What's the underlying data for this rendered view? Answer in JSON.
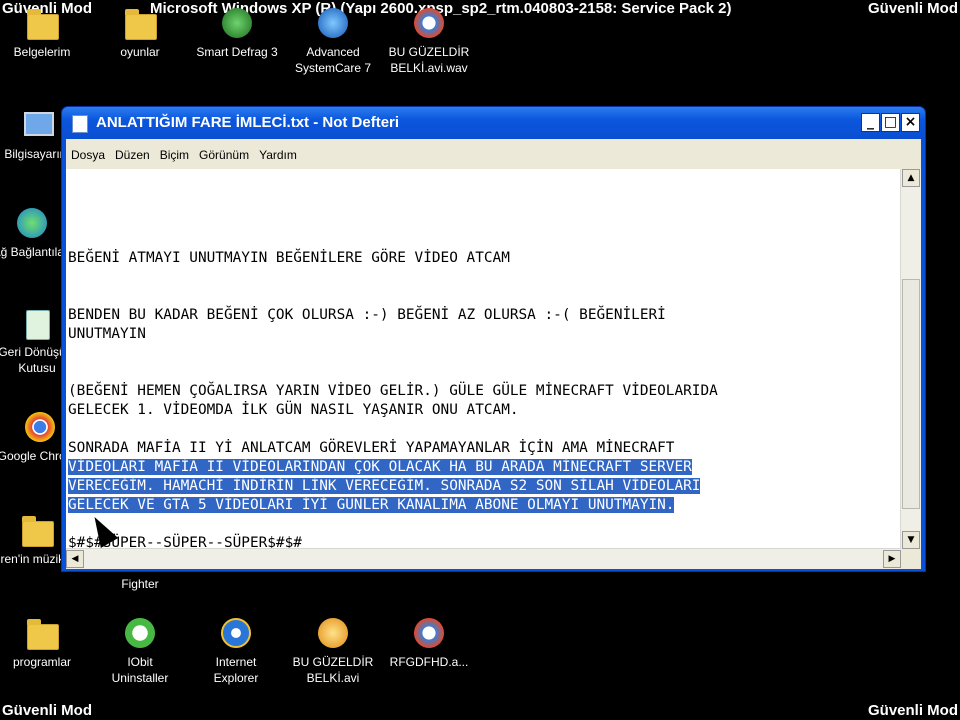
{
  "top_info": "Microsoft Windows XP (R) (Yapı 2600.xpsp_sp2_rtm.040803-2158: Service Pack 2)",
  "mode_labels": {
    "top_left": "Güvenli Mod",
    "top_right": "Güvenli Mod",
    "bottom_left": "Güvenli Mod",
    "bottom_right": "Güvenli Mod"
  },
  "desktop_icons": {
    "belgelerim": "Belgelerim",
    "oyunlar": "oyunlar",
    "smart_defrag": "Smart Defrag 3",
    "advanced_systemcare_1": "Advanced",
    "advanced_systemcare_2": "SystemCare 7",
    "bu_guzeldir_wav_1": "BU GÜZELDİR",
    "bu_guzeldir_wav_2": "BELKİ.avi.wav",
    "bilgisayarim": "Bilgisayarım",
    "ag_baglantilari": "Ağ Bağlantıları",
    "geri_donusum_1": "Geri Dönüşüm",
    "geri_donusum_2": "Kutusu",
    "google_chrome": "Google Chrome",
    "eren_muzik": "eren'in müzikleri",
    "fighter": "Fighter",
    "programlar": "programlar",
    "iobit_1": "IObit",
    "iobit_2": "Uninstaller",
    "ie_1": "Internet",
    "ie_2": "Explorer",
    "bu_guzeldir_avi_1": "BU GÜZELDİR",
    "bu_guzeldir_avi_2": "BELKİ.avi",
    "rfgdfhd": "RFGDFHD.a..."
  },
  "notepad": {
    "title": "ANLATTIĞIM FARE İMLECİ.txt - Not Defteri",
    "buttons": {
      "minimize": "_",
      "maximize": "□",
      "close": "×"
    },
    "menu": [
      "Dosya",
      "Düzen",
      "Biçim",
      "Görünüm",
      "Yardım"
    ],
    "lines": [
      "BEĞENİ ATMAYI UNUTMAYIN BEĞENİLERE GÖRE VİDEO ATCAM",
      "BENDEN BU KADAR BEĞENİ ÇOK OLURSA :-) BEĞENİ AZ OLURSA :-( BEĞENİLERİ",
      "UNUTMAYIN",
      "(BEĞENİ HEMEN ÇOĞALIRSA YARIN VİDEO GELİR.) GÜLE GÜLE MİNECRAFT VİDEOLARIDA",
      "GELECEK 1. VİDEOMDA İLK GÜN NASIL YAŞANIR ONU ATCAM.",
      "SONRADA MAFİA II Yİ ANLATCAM GÖREVLERİ YAPAMAYANLAR İÇİN AMA MİNECRAFT",
      "VİDEOLARI MAFİA II VİDEOLARINDAN ÇOK OLACAK HA BU ARADA MİNECRAFT SERVER",
      "VERECEĞİM. HAMACHİ İNDİRİN LİNK VERECEĞİM. SONRADA S2 SON SİLAH VİDEOLARI",
      "GELECEK VE GTA 5 VİDEOLARI İYİ GÜNLER KANALIMA ABONE OLMAYI UNUTMAYIN.",
      "$#$#SÜPER--SÜPER--SÜPER$#$#"
    ],
    "scroll": {
      "up": "▲",
      "down": "▼",
      "left": "◀",
      "right": "▶"
    }
  },
  "colors": {
    "desktop": "#000000",
    "title_bar": "#0a51d9",
    "selection": "#3166c4",
    "menu_bg": "#ece9d8"
  }
}
